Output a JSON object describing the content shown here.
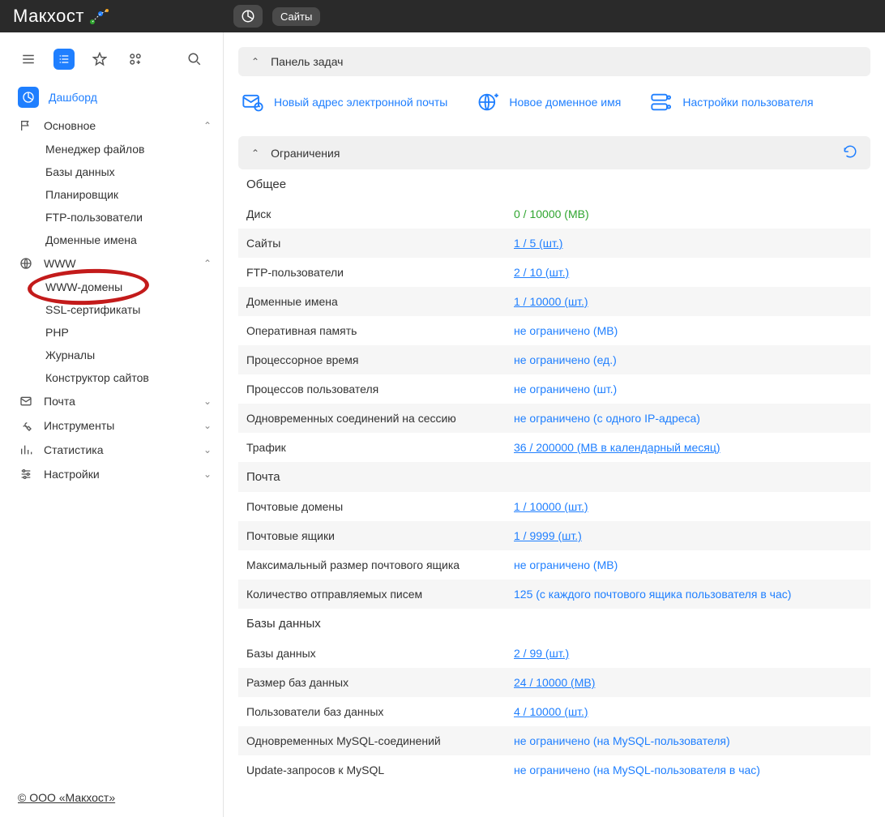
{
  "topbar": {
    "brand": "Макхост",
    "tab": "Сайты"
  },
  "sidebar": {
    "dashboard": "Дашборд",
    "basic": {
      "label": "Основное",
      "items": [
        "Менеджер файлов",
        "Базы данных",
        "Планировщик",
        "FTP-пользователи",
        "Доменные имена"
      ]
    },
    "www": {
      "label": "WWW",
      "items": [
        "WWW-домены",
        "SSL-сертификаты",
        "PHP",
        "Журналы",
        "Конструктор сайтов"
      ]
    },
    "mail": "Почта",
    "tools": "Инструменты",
    "stats": "Статистика",
    "settings": "Настройки",
    "footer": "© ООО «Макхост»"
  },
  "panel": {
    "tasks_header": "Панель задач",
    "limits_header": "Ограничения",
    "actions": {
      "new_email": "Новый адрес электронной почты",
      "new_domain": "Новое доменное имя",
      "user_settings": "Настройки пользователя"
    },
    "sections": {
      "general": "Общее",
      "mail": "Почта",
      "db": "Базы данных"
    },
    "rows": {
      "disk": {
        "label": "Диск",
        "value": "0 / 10000 (MB)"
      },
      "sites": {
        "label": "Сайты",
        "value": "1 / 5 (шт.)"
      },
      "ftp": {
        "label": "FTP-пользователи",
        "value": "2 / 10 (шт.)"
      },
      "domains": {
        "label": "Доменные имена",
        "value": "1 / 10000 (шт.)"
      },
      "ram": {
        "label": "Оперативная память",
        "value": "не ограничено (MB)"
      },
      "cpu": {
        "label": "Процессорное время",
        "value": "не ограничено (ед.)"
      },
      "proc": {
        "label": "Процессов пользователя",
        "value": "не ограничено (шт.)"
      },
      "conn": {
        "label": "Одновременных соединений на сессию",
        "value": "не ограничено (с одного IP-адреса)"
      },
      "traffic": {
        "label": "Трафик",
        "value": "36 / 200000 (MB в календарный месяц)"
      },
      "mail_domains": {
        "label": "Почтовые домены",
        "value": "1 / 10000 (шт.)"
      },
      "mailboxes": {
        "label": "Почтовые ящики",
        "value": "1 / 9999 (шт.)"
      },
      "mailbox_max": {
        "label": "Максимальный размер почтового ящика",
        "value": "не ограничено (MB)"
      },
      "mail_send": {
        "label": "Количество отправляемых писем",
        "value": "125 (с каждого почтового ящика пользователя в час)"
      },
      "dbs": {
        "label": "Базы данных",
        "value": "2 / 99 (шт.)"
      },
      "db_size": {
        "label": "Размер баз данных",
        "value": "24 / 10000 (MB)"
      },
      "db_users": {
        "label": "Пользователи баз данных",
        "value": "4 / 10000 (шт.)"
      },
      "mysql_conn": {
        "label": "Одновременных MySQL-соединений",
        "value": "не ограничено (на MySQL-пользователя)"
      },
      "mysql_upd": {
        "label": "Update-запросов к MySQL",
        "value": "не ограничено (на MySQL-пользователя в час)"
      }
    }
  }
}
